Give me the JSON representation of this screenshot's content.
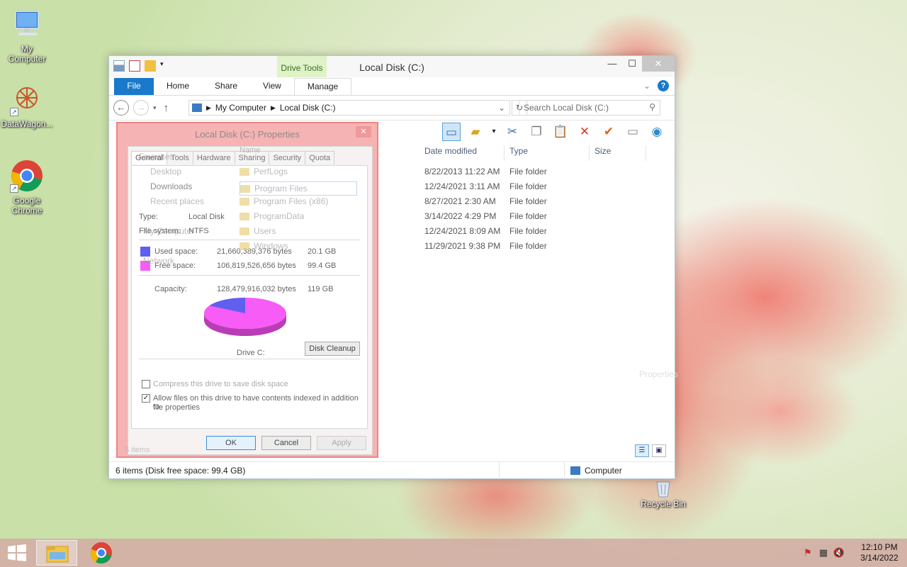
{
  "desktop": {
    "icons": [
      {
        "label_line1": "My",
        "label_line2": "Computer",
        "icon": "computer-icon"
      },
      {
        "label_line1": "DataWagon...",
        "label_line2": "",
        "icon": "datawagon-icon"
      },
      {
        "label_line1": "Google",
        "label_line2": "Chrome",
        "icon": "chrome-icon"
      },
      {
        "label_line1": "Recycle Bin",
        "label_line2": "",
        "icon": "recycle-bin-icon"
      }
    ]
  },
  "explorer": {
    "title": "Local Disk (C:)",
    "contextual_group": "Drive Tools",
    "tabs": [
      "File",
      "Home",
      "Share",
      "View",
      "Manage"
    ],
    "address": {
      "crumbs": [
        "My Computer",
        "Local Disk (C:)"
      ]
    },
    "search_placeholder": "Search Local Disk (C:)",
    "columns": [
      "Date modified",
      "Type",
      "Size"
    ],
    "rows": [
      {
        "date": "8/22/2013 11:22 AM",
        "type": "File folder"
      },
      {
        "date": "12/24/2021 3:11 AM",
        "type": "File folder"
      },
      {
        "date": "8/27/2021 2:30 AM",
        "type": "File folder"
      },
      {
        "date": "3/14/2022 4:29 PM",
        "type": "File folder"
      },
      {
        "date": "12/24/2021 8:09 AM",
        "type": "File folder"
      },
      {
        "date": "11/29/2021 9:38 PM",
        "type": "File folder"
      }
    ],
    "ghost_properties": "Properties",
    "status_left": "6 items (Disk free space: 99.4 GB)",
    "status_right": "Computer"
  },
  "nav_ghost": {
    "items": [
      "Favorites",
      "Desktop",
      "Downloads",
      "Recent places",
      "My Computer",
      "Network"
    ],
    "name_header": "Name",
    "folders": [
      "PerfLogs",
      "Program Files",
      "Program Files (x86)",
      "ProgramData",
      "Users",
      "Windows"
    ],
    "items_count": "6 items"
  },
  "properties": {
    "title": "Local Disk (C:) Properties",
    "tabs": [
      "General",
      "Tools",
      "Hardware",
      "Sharing",
      "Security",
      "Quota"
    ],
    "type_label": "Type:",
    "type_value": "Local Disk",
    "fs_label": "File system:",
    "fs_value": "NTFS",
    "used_label": "Used space:",
    "used_bytes": "21,660,389,376 bytes",
    "used_gb": "20.1 GB",
    "free_label": "Free space:",
    "free_bytes": "106,819,526,656 bytes",
    "free_gb": "99.4 GB",
    "capacity_label": "Capacity:",
    "capacity_bytes": "128,479,916,032 bytes",
    "capacity_gb": "119 GB",
    "drive_label": "Drive C:",
    "disk_cleanup": "Disk Cleanup",
    "compress_label": "Compress this drive to save disk space",
    "index_label_1": "Allow files on this drive to have contents indexed in addition to",
    "index_label_2": "file properties",
    "ok": "OK",
    "cancel": "Cancel",
    "apply": "Apply",
    "used_fraction": 0.169,
    "colors": {
      "used": "#5f5ff0",
      "free": "#f85cf6"
    }
  },
  "taskbar": {
    "time": "12:10 PM",
    "date": "3/14/2022"
  }
}
